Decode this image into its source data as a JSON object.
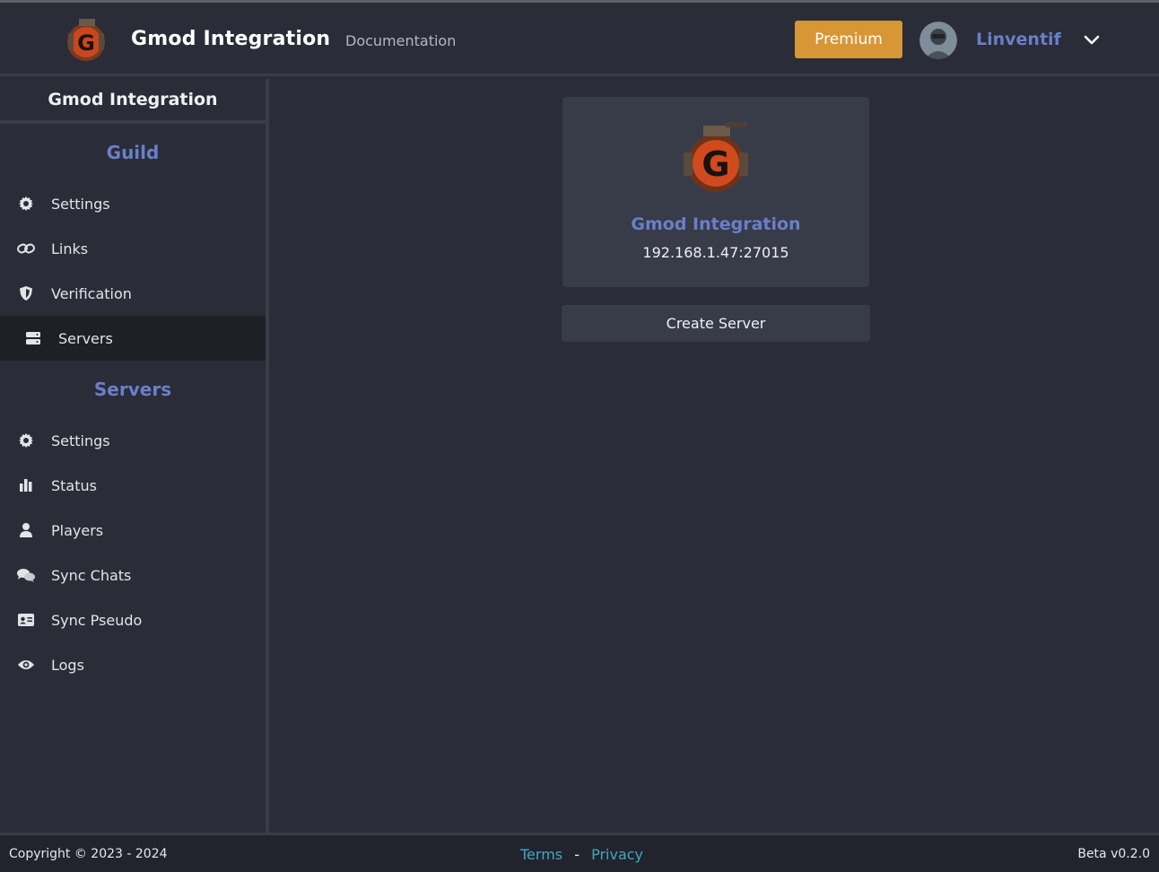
{
  "header": {
    "brand": "Gmod Integration",
    "documentation": "Documentation",
    "premium": "Premium",
    "username": "Linventif"
  },
  "sidebar": {
    "title": "Gmod Integration",
    "guild_heading": "Guild",
    "guild_items": [
      {
        "label": "Settings",
        "icon": "gear-icon"
      },
      {
        "label": "Links",
        "icon": "link-icon"
      },
      {
        "label": "Verification",
        "icon": "shield-icon"
      },
      {
        "label": "Servers",
        "icon": "server-icon"
      }
    ],
    "servers_heading": "Servers",
    "server_items": [
      {
        "label": "Settings",
        "icon": "gear-icon"
      },
      {
        "label": "Status",
        "icon": "bar-chart-icon"
      },
      {
        "label": "Players",
        "icon": "user-icon"
      },
      {
        "label": "Sync Chats",
        "icon": "chat-icon"
      },
      {
        "label": "Sync Pseudo",
        "icon": "id-card-icon"
      },
      {
        "label": "Logs",
        "icon": "eye-icon"
      }
    ]
  },
  "main": {
    "server_card": {
      "name": "Gmod Integration",
      "address": "192.168.1.47:27015"
    },
    "create_button": "Create Server"
  },
  "footer": {
    "copyright": "Copyright © 2023 - 2024",
    "terms": "Terms",
    "separator": "-",
    "privacy": "Privacy",
    "version": "Beta v0.2.0"
  },
  "colors": {
    "accent": "#6a7fc9",
    "premium": "#d89736",
    "link": "#41a6c4",
    "background": "#2a2c38"
  }
}
